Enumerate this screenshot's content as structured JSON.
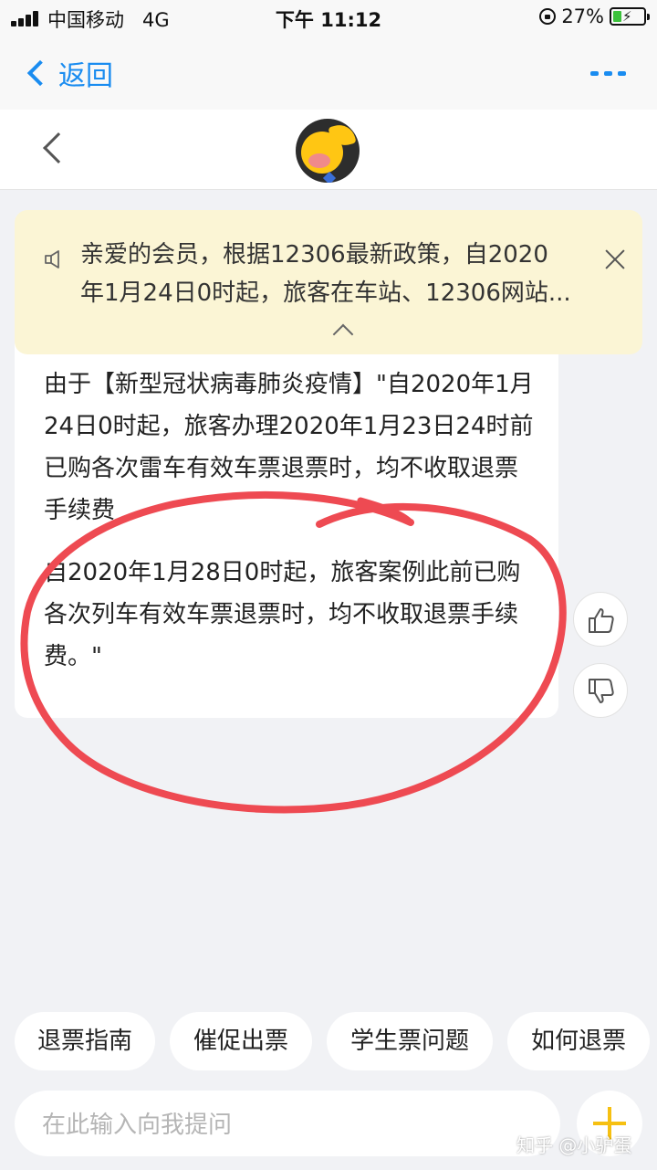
{
  "status_bar": {
    "carrier": "中国移动",
    "network": "4G",
    "time": "下午 11:12",
    "battery_percent": "27%",
    "battery_level": 0.27
  },
  "nav": {
    "back_label": "返回"
  },
  "notice": {
    "line1": "亲爱的会员，根据12306最新政策，自2020",
    "line2": "年1月24日0时起，旅客在车站、12306网站..."
  },
  "message": {
    "paragraph1": "由于【新型冠状病毒肺炎疫情】\"自2020年1月24日0时起，旅客办理2020年1月23日24时前已购各次雷车有效车票退票时，均不收取退票手续费",
    "paragraph2": "自2020年1月28日0时起，旅客案例此前已购各次列车有效车票退票时，均不收取退票手续费。\""
  },
  "quick_replies": [
    "退票指南",
    "催促出票",
    "学生票问题",
    "如何退票"
  ],
  "input": {
    "placeholder": "在此输入向我提问"
  },
  "watermark": "知乎 @小驴蛋",
  "colors": {
    "accent_blue": "#1a8cf0",
    "notice_bg": "#fbf5d5",
    "annotation_red": "#ee4a52",
    "plus_yellow": "#f6c012"
  }
}
